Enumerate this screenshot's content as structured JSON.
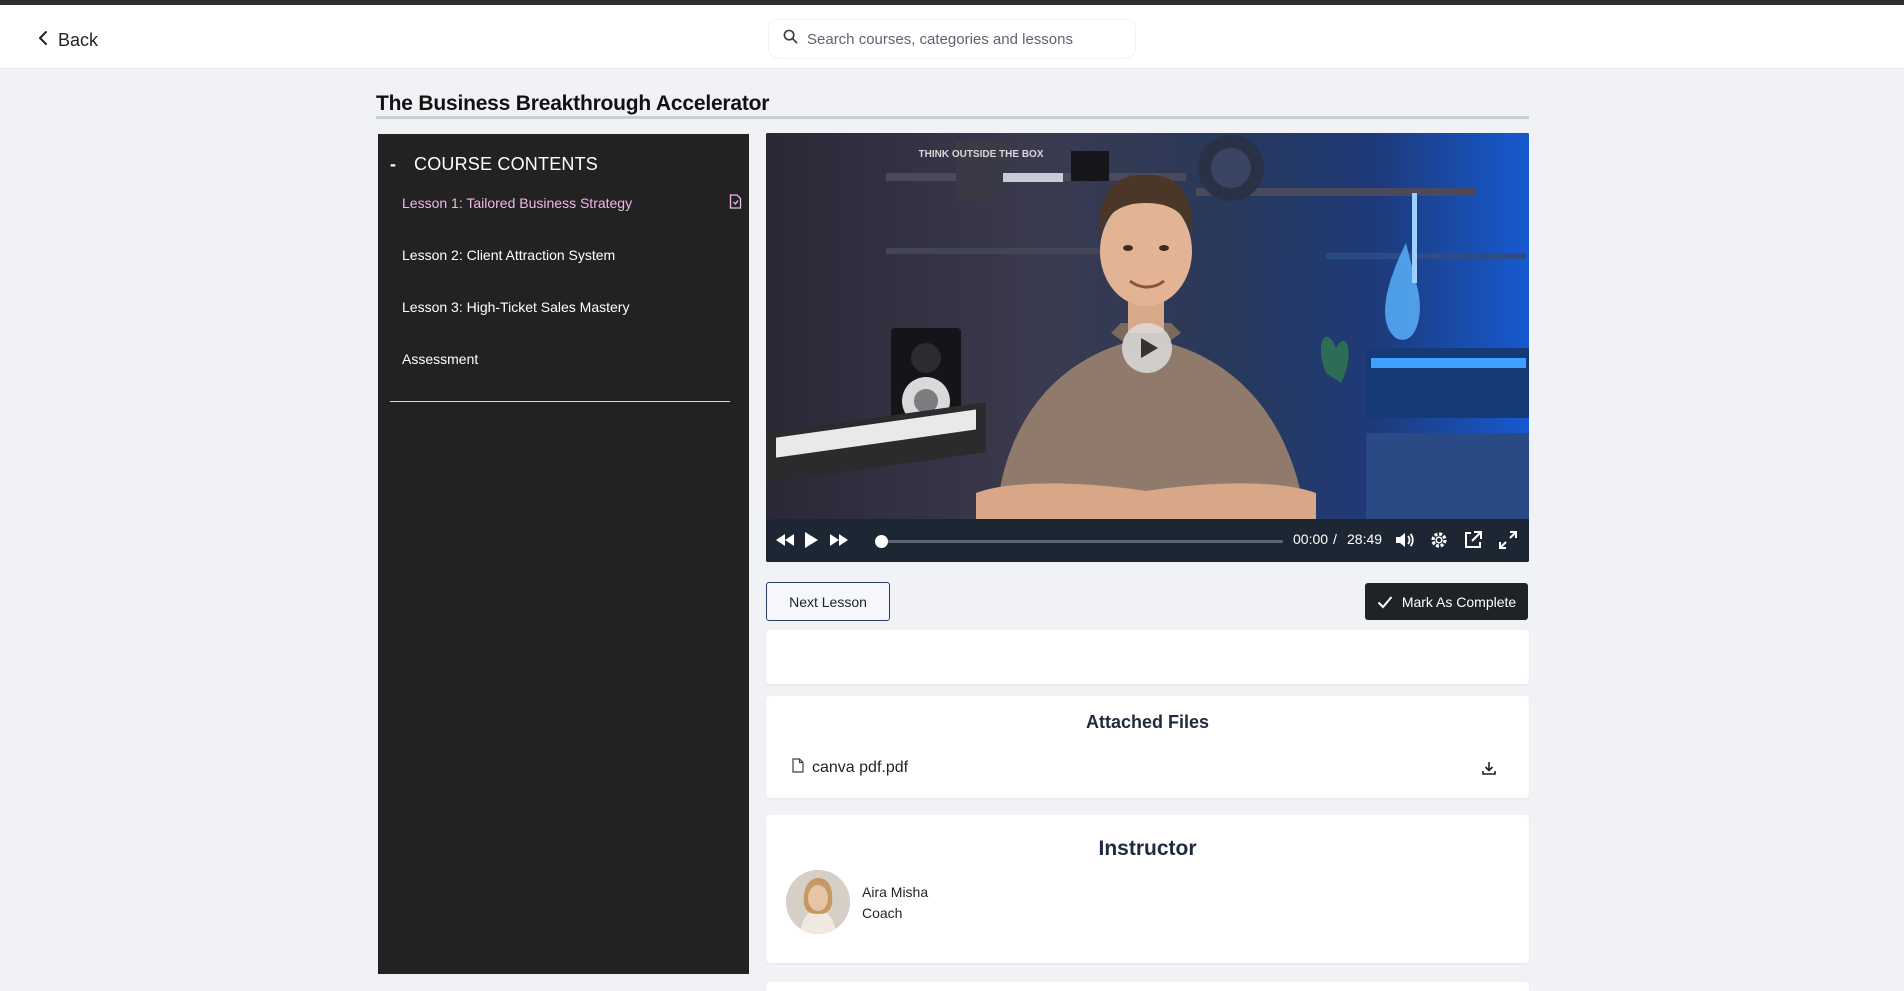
{
  "header": {
    "back_label": "Back",
    "search_placeholder": "Search courses, categories and lessons"
  },
  "course": {
    "title": "The Business Breakthrough Accelerator"
  },
  "sidebar": {
    "heading": "COURSE CONTENTS",
    "collapse_symbol": "-",
    "items": [
      {
        "label": "Lesson 1: Tailored Business Strategy",
        "active": true
      },
      {
        "label": "Lesson 2: Client Attraction System"
      },
      {
        "label": "Lesson 3: High-Ticket Sales Mastery"
      },
      {
        "label": "Assessment"
      }
    ]
  },
  "player": {
    "current_time": "00:00",
    "separator": "/",
    "duration": "28:49",
    "progress_fraction": 0.0,
    "frame_text": "THINK OUTSIDE THE BOX"
  },
  "actions": {
    "next_label": "Next Lesson",
    "complete_label": "Mark As Complete"
  },
  "files": {
    "title": "Attached Files",
    "items": [
      {
        "name": "canva pdf.pdf"
      }
    ]
  },
  "instructor": {
    "title": "Instructor",
    "name": "Aira Misha",
    "role": "Coach"
  },
  "colors": {
    "active_lesson": "#f2b6ea",
    "sidebar_bg": "#222222",
    "page_bg": "#f0f2f6",
    "primary_button": "#1f2226"
  },
  "icons": {
    "back": "chevron-left-icon",
    "search": "search-icon",
    "lesson_resource": "file-icon",
    "file": "file-icon",
    "download": "download-icon",
    "check": "check-icon"
  }
}
